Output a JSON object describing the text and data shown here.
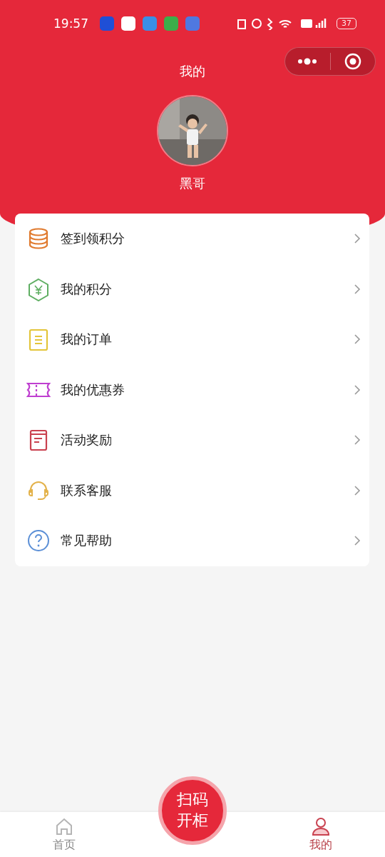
{
  "status_bar": {
    "time": "19:57",
    "battery": "37"
  },
  "header": {
    "title": "我的"
  },
  "profile": {
    "name": "黑哥"
  },
  "menu": [
    {
      "label": "签到领积分",
      "kind": "coins"
    },
    {
      "label": "我的积分",
      "kind": "yuan"
    },
    {
      "label": "我的订单",
      "kind": "clipboard"
    },
    {
      "label": "我的优惠券",
      "kind": "ticket"
    },
    {
      "label": "活动奖励",
      "kind": "book"
    },
    {
      "label": "联系客服",
      "kind": "headset"
    },
    {
      "label": "常见帮助",
      "kind": "help"
    }
  ],
  "scan_button": {
    "label": "扫码开柜"
  },
  "tab_bar": [
    {
      "label": "首页",
      "kind": "home",
      "selected": false
    },
    {
      "label": "我的",
      "kind": "user",
      "selected": true
    }
  ]
}
